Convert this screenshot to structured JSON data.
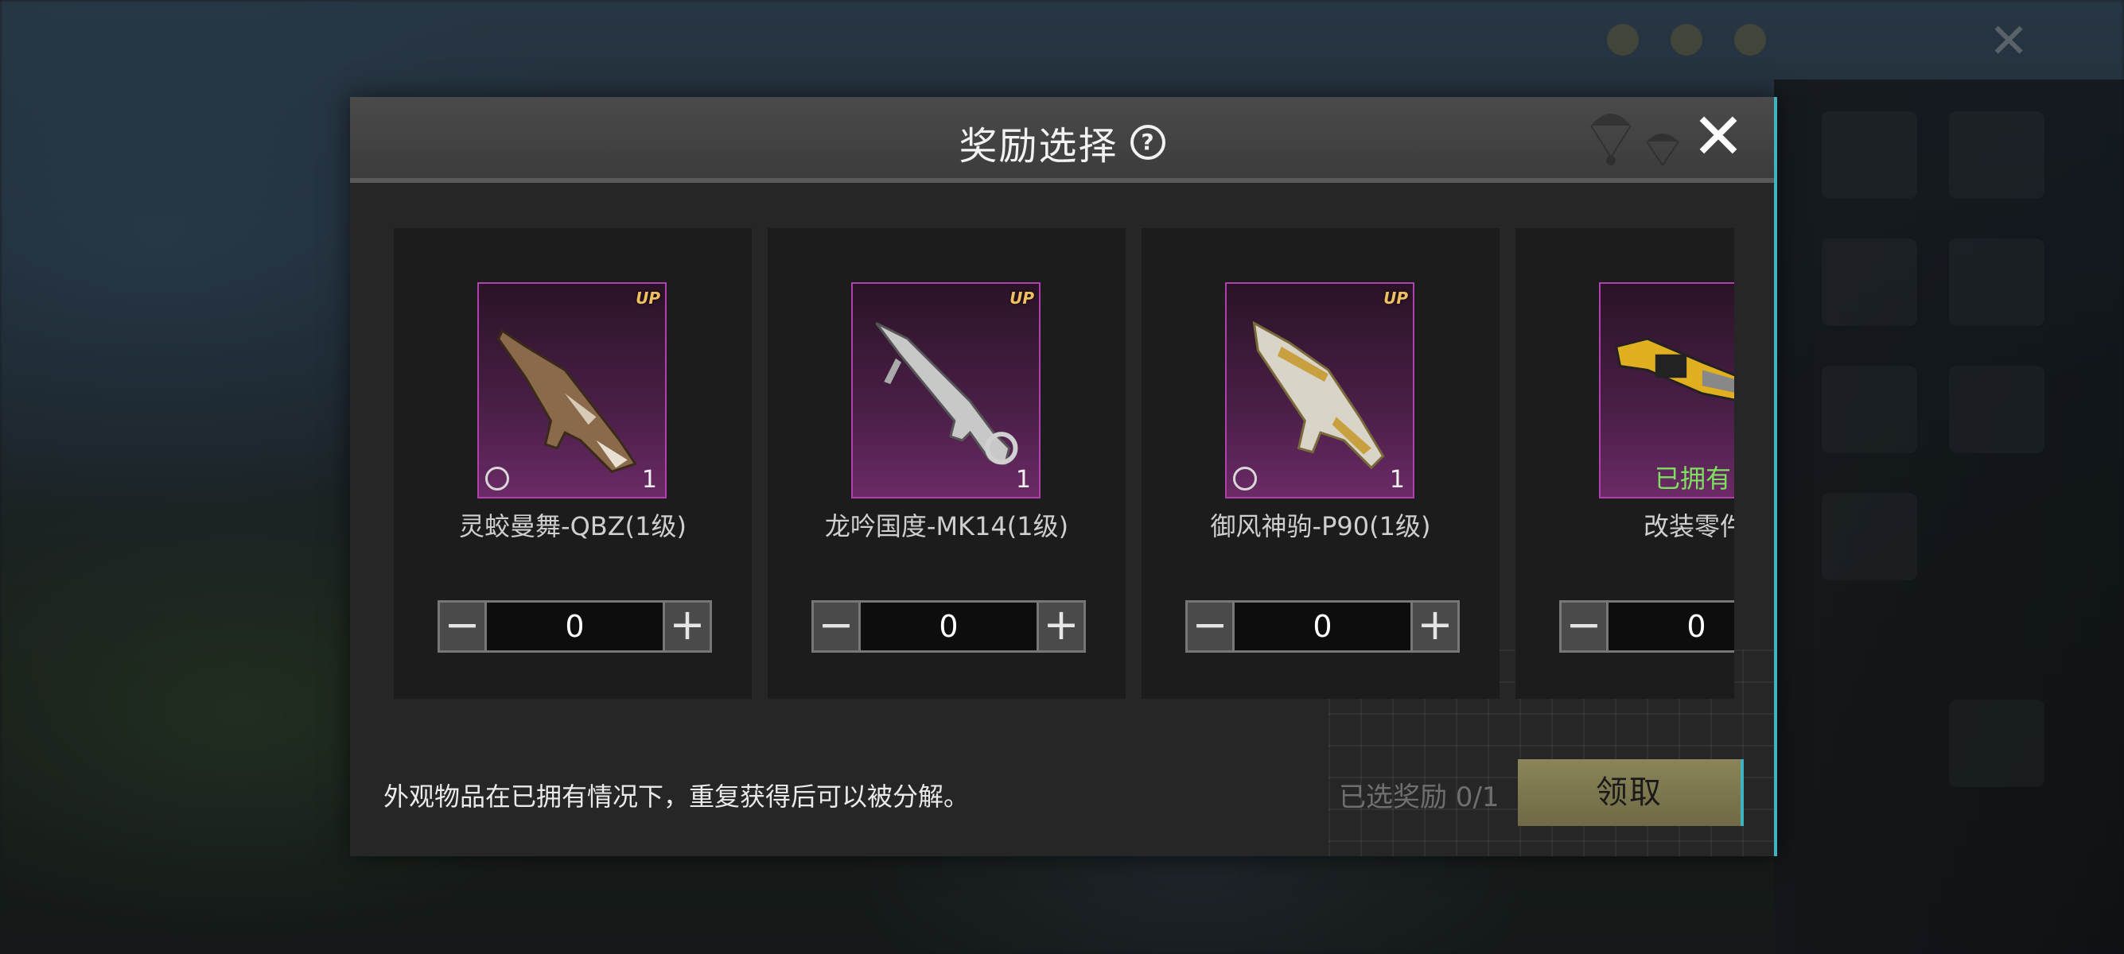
{
  "dialog": {
    "title": "奖励选择",
    "help_glyph": "?",
    "close_glyph": "✕"
  },
  "items": [
    {
      "name": "灵蛟曼舞-QBZ(1级)",
      "count": "1",
      "quantity": "0",
      "upgrade_badge": "UP",
      "owned": ""
    },
    {
      "name": "龙吟国度-MK14(1级)",
      "count": "1",
      "quantity": "0",
      "upgrade_badge": "UP",
      "owned": ""
    },
    {
      "name": "御风神驹-P90(1级)",
      "count": "1",
      "quantity": "0",
      "upgrade_badge": "UP",
      "owned": ""
    },
    {
      "name": "改装零件",
      "count": "",
      "quantity": "0",
      "upgrade_badge": "",
      "owned": "已拥有"
    }
  ],
  "stepper": {
    "minus": "−",
    "plus": "+"
  },
  "footer": {
    "note": "外观物品在已拥有情况下，重复获得后可以被分解。",
    "selected": "已选奖励 0/1",
    "claim_button": "领取"
  },
  "colors": {
    "rarity_border": "#b23fb0",
    "accent_cyan": "#3fb4c0",
    "owned_green": "#7fe060",
    "claim_bg": "#8a8458"
  }
}
